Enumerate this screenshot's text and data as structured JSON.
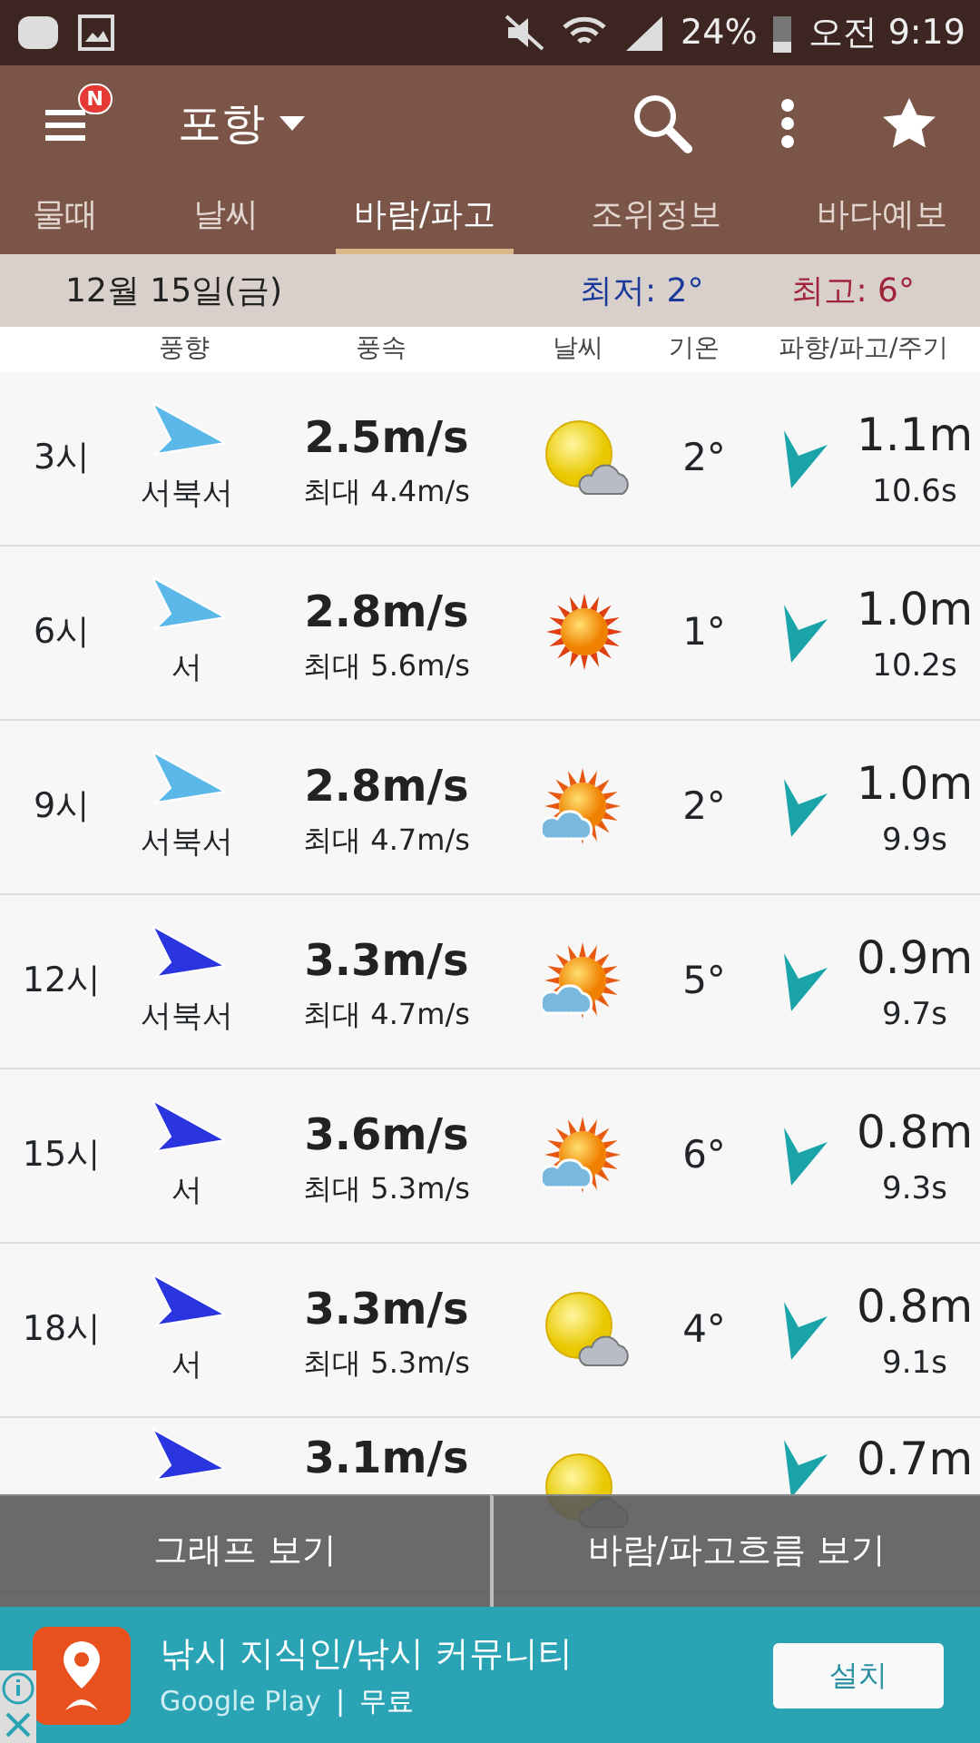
{
  "status_bar": {
    "battery": "24%",
    "time": "오전 9:19"
  },
  "app_bar": {
    "location": "포항",
    "menu_badge": "N"
  },
  "tabs": [
    {
      "label": "물때",
      "selected": false
    },
    {
      "label": "날씨",
      "selected": false
    },
    {
      "label": "바람/파고",
      "selected": true
    },
    {
      "label": "조위정보",
      "selected": false
    },
    {
      "label": "바다예보",
      "selected": false
    }
  ],
  "date_bar": {
    "date": "12월 15일(금)",
    "low": "최저: 2°",
    "high": "최고: 6°"
  },
  "columns": [
    "풍향",
    "풍속",
    "날씨",
    "기온",
    "파향/파고/주기"
  ],
  "rows": [
    {
      "time": "3시",
      "wind": {
        "direction": "서북서",
        "color": "#5bb8e8"
      },
      "speed": "2.5m/s",
      "max": "최대 4.4m/s",
      "weather": {
        "kind": "sun-cloud"
      },
      "temp": "2°",
      "wave": "1.1m",
      "period": "10.6s"
    },
    {
      "time": "6시",
      "wind": {
        "direction": "서",
        "color": "#5bb8e8"
      },
      "speed": "2.8m/s",
      "max": "최대 5.6m/s",
      "weather": {
        "kind": "sun"
      },
      "temp": "1°",
      "wave": "1.0m",
      "period": "10.2s"
    },
    {
      "time": "9시",
      "wind": {
        "direction": "서북서",
        "color": "#5bb8e8"
      },
      "speed": "2.8m/s",
      "max": "최대 4.7m/s",
      "weather": {
        "kind": "cloud-sun"
      },
      "temp": "2°",
      "wave": "1.0m",
      "period": "9.9s"
    },
    {
      "time": "12시",
      "wind": {
        "direction": "서북서",
        "color": "#2a35e0"
      },
      "speed": "3.3m/s",
      "max": "최대 4.7m/s",
      "weather": {
        "kind": "cloud-sun"
      },
      "temp": "5°",
      "wave": "0.9m",
      "period": "9.7s"
    },
    {
      "time": "15시",
      "wind": {
        "direction": "서",
        "color": "#2a35e0"
      },
      "speed": "3.6m/s",
      "max": "최대 5.3m/s",
      "weather": {
        "kind": "cloud-sun"
      },
      "temp": "6°",
      "wave": "0.8m",
      "period": "9.3s"
    },
    {
      "time": "18시",
      "wind": {
        "direction": "서",
        "color": "#2a35e0"
      },
      "speed": "3.3m/s",
      "max": "최대 5.3m/s",
      "weather": {
        "kind": "sun-cloud"
      },
      "temp": "4°",
      "wave": "0.8m",
      "period": "9.1s"
    },
    {
      "wind": {
        "color": "#2a35e0"
      },
      "speed": "3.1m/s",
      "weather": {
        "kind": "sun-cloud"
      },
      "wave": "0.7m"
    }
  ],
  "bottom_buttons": [
    "그래프 보기",
    "바람/파고흐름 보기"
  ],
  "ad": {
    "title": "낚시 지식인/낚시 커뮤니티",
    "store": "Google Play",
    "separator": "|",
    "price": "무료",
    "install": "설치"
  }
}
